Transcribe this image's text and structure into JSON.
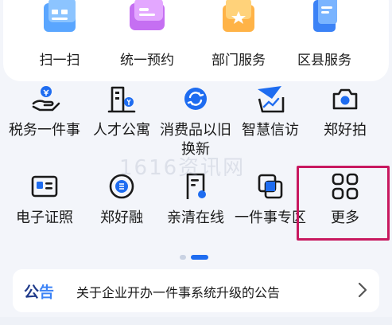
{
  "colors": {
    "accent": "#1e6cf0",
    "highlight_border": "#c8185f",
    "text": "#1a1a1a",
    "notice_tag_dark": "#1f3a8a",
    "notice_tag_light": "#3b82f6"
  },
  "top_services": [
    {
      "label": "扫一扫",
      "icon": "folder-scan-icon"
    },
    {
      "label": "统一预约",
      "icon": "card-appointment-icon"
    },
    {
      "label": "部门服务",
      "icon": "star-folder-icon"
    },
    {
      "label": "区县服务",
      "icon": "document-stack-icon"
    }
  ],
  "grid": [
    {
      "label": "税务一件事",
      "icon": "tax-hand-icon"
    },
    {
      "label": "人才公寓",
      "icon": "apartment-building-icon"
    },
    {
      "label": "消费品以旧换新",
      "icon": "recycle-exchange-icon"
    },
    {
      "label": "智慧信访",
      "icon": "paper-plane-icon"
    },
    {
      "label": "郑好拍",
      "icon": "camera-icon"
    },
    {
      "label": "电子证照",
      "icon": "id-card-icon"
    },
    {
      "label": "郑好融",
      "icon": "coin-stack-icon"
    },
    {
      "label": "亲清在线",
      "icon": "certificate-icon"
    },
    {
      "label": "一件事专区",
      "icon": "layers-icon"
    },
    {
      "label": "更多",
      "icon": "grid-more-icon"
    }
  ],
  "watermark": "1616资讯网",
  "notice": {
    "tag": "公告",
    "text": "关于企业开办一件事系统升级的公告"
  }
}
